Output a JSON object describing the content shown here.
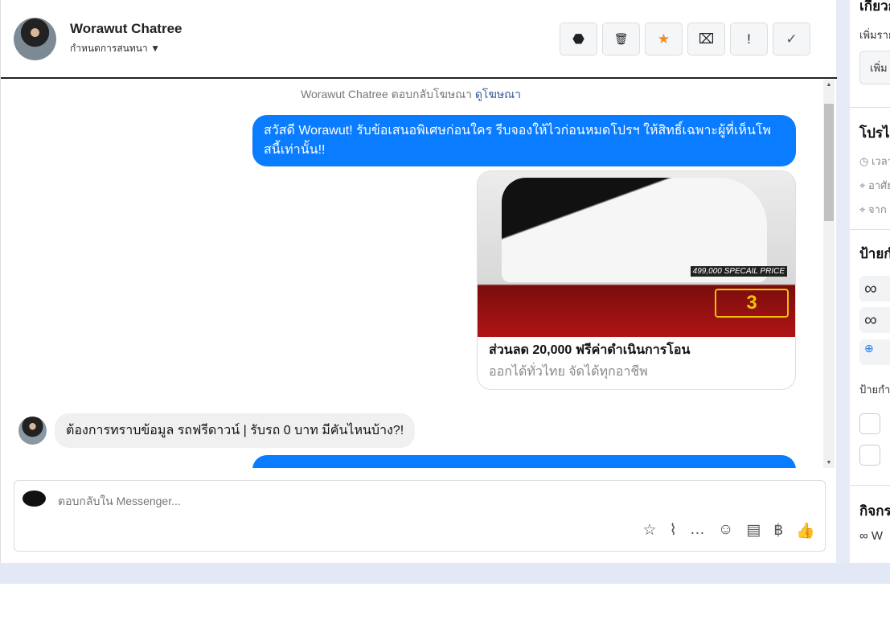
{
  "header": {
    "name": "Worawut Chatree",
    "subtitle": "กำหนดการสนทนา ▼",
    "actions": [
      {
        "icon": "spam-icon",
        "glyph": "⬣"
      },
      {
        "icon": "trash-icon",
        "glyph": "🗑"
      },
      {
        "icon": "star-icon",
        "glyph": "★"
      },
      {
        "icon": "mark-unread-icon",
        "glyph": "⌧"
      },
      {
        "icon": "important-icon",
        "glyph": "!"
      },
      {
        "icon": "done-icon",
        "glyph": "✓"
      }
    ]
  },
  "chat": {
    "system_text": "Worawut Chatree ตอบกลับโฆษณา",
    "system_link": "ดูโฆษณา",
    "message1": "สวัสดี Worawut! รับข้อเสนอพิเศษก่อนใคร รีบจองให้ไวก่อนหมดโปรฯ ให้สิทธิ์เฉพาะผู้ที่เห็นโพสนี้เท่านั้น!!",
    "card": {
      "price": "499,000 SPECAIL PRICE",
      "promo": "3",
      "title": "ส่วนลด 20,000 ฟรีค่าดำเนินการโอน",
      "subtitle": "ออกได้ทั่วไทย จัดได้ทุกอาชีพ"
    },
    "incoming": "ต้องการทราบข้อมูล รถฟรีดาวน์ | รับรถ 0 บาท มีคันไหนบ้าง?!"
  },
  "composer": {
    "placeholder": "ตอบกลับใน Messenger...",
    "tools": [
      "☆",
      "⌇",
      "…",
      "☺",
      "▤",
      "฿",
      "👍"
    ]
  },
  "right": {
    "about": "เกี่ยวกับ",
    "add_text": "เพิ่มรายละเอียด",
    "add_btn": "เพิ่ม",
    "profile": "โปรไฟล์",
    "time": "เวลา",
    "addr": "อาศัย",
    "from": "จาก",
    "labels": "ป้ายกำกับ",
    "labels2": "ป้ายกำกับ",
    "activity": "กิจกรรม",
    "act_item": "W"
  },
  "colors": {
    "accent": "#0a7cff",
    "star": "#f58a1f"
  }
}
